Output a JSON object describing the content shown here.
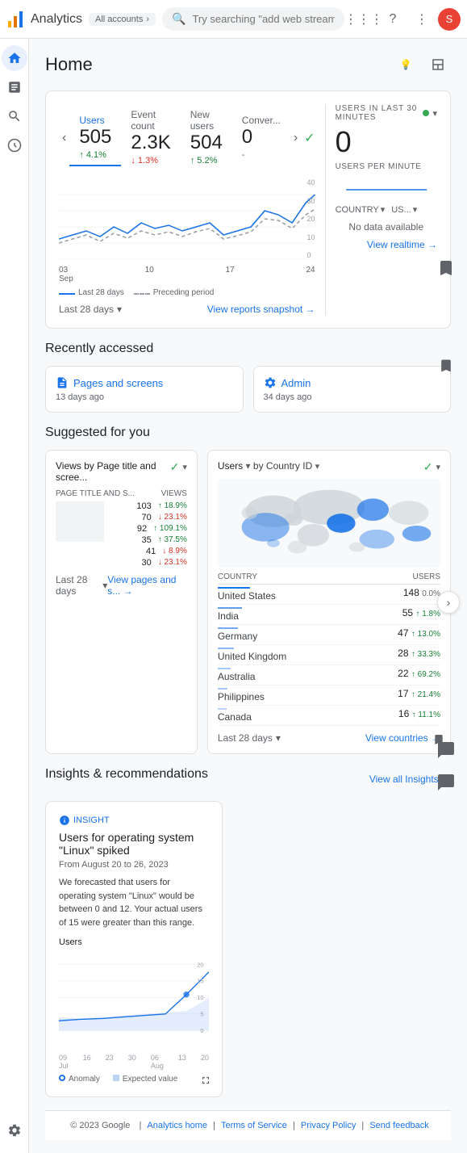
{
  "app": {
    "title": "Analytics",
    "account": "All accounts",
    "search_placeholder": "Try searching \"add web stream\"",
    "avatar_letter": "S"
  },
  "sidebar": {
    "items": [
      {
        "id": "home",
        "icon": "⌂",
        "label": "Home",
        "active": true
      },
      {
        "id": "reports",
        "icon": "📊",
        "label": "Reports"
      },
      {
        "id": "explore",
        "icon": "🔍",
        "label": "Explore"
      },
      {
        "id": "advertising",
        "icon": "📣",
        "label": "Advertising"
      },
      {
        "id": "configure",
        "icon": "⚙",
        "label": "Configure"
      }
    ]
  },
  "page": {
    "title": "Home"
  },
  "metrics": {
    "tabs": [
      {
        "id": "users",
        "label": "Users",
        "value": "505",
        "change": "↑ 4.1%",
        "change_type": "up"
      },
      {
        "id": "event_count",
        "label": "Event count",
        "value": "2.3K",
        "change": "↓ 1.3%",
        "change_type": "down"
      },
      {
        "id": "new_users",
        "label": "New users",
        "value": "504",
        "change": "↑ 5.2%",
        "change_type": "up"
      },
      {
        "id": "conversions",
        "label": "Conver...",
        "value": "0",
        "change": "-",
        "change_type": "neutral"
      }
    ],
    "chart_labels": [
      "03 Sep",
      "10",
      "17",
      "24"
    ],
    "chart_y_labels": [
      "40",
      "30",
      "20",
      "10",
      "0"
    ],
    "legend_solid": "Last 28 days",
    "legend_dashed": "Preceding period",
    "date_range": "Last 28 days",
    "view_link": "View reports snapshot →"
  },
  "realtime": {
    "title": "USERS IN LAST 30 MINUTES",
    "value": "0",
    "subtitle": "USERS PER MINUTE",
    "country_label": "COUNTRY",
    "us_label": "US...",
    "no_data": "No data available",
    "view_link": "View realtime →"
  },
  "recently_accessed": {
    "title": "Recently accessed",
    "items": [
      {
        "id": "pages-screens",
        "icon": "📄",
        "title": "Pages and screens",
        "sub": "13 days ago"
      },
      {
        "id": "admin",
        "icon": "⚙",
        "title": "Admin",
        "sub": "34 days ago"
      }
    ]
  },
  "suggested": {
    "title": "Suggested for you",
    "card1": {
      "title": "Views by Page title and scree...",
      "filter_label": "Views",
      "filter_icon": "✓",
      "columns": [
        "PAGE TITLE AND S...",
        "VIEWS"
      ],
      "rows": [
        {
          "views": "103",
          "change": "↑ 18.9%",
          "change_type": "up"
        },
        {
          "views": "70",
          "change": "↓ 23.1%",
          "change_type": "down"
        },
        {
          "views": "92",
          "change": "↑ 109.1%",
          "change_type": "up"
        },
        {
          "views": "35",
          "change": "↑ 37.5%",
          "change_type": "up"
        },
        {
          "views": "41",
          "change": "↓ 8.9%",
          "change_type": "down"
        },
        {
          "views": "30",
          "change": "↓ 23.1%",
          "change_type": "down"
        }
      ],
      "date_range": "Last 28 days",
      "view_link": "View pages and s... →"
    },
    "card2": {
      "title": "Users",
      "filter_label": "by Country ID",
      "filter_icon": "✓",
      "columns": [
        "COUNTRY",
        "USERS"
      ],
      "rows": [
        {
          "country": "United States",
          "users": "148",
          "change": "0.0%",
          "change_type": "neutral"
        },
        {
          "country": "India",
          "users": "55",
          "change": "↑ 1.8%",
          "change_type": "up"
        },
        {
          "country": "Germany",
          "users": "47",
          "change": "↑ 13.0%",
          "change_type": "up"
        },
        {
          "country": "United Kingdom",
          "users": "28",
          "change": "↑ 33.3%",
          "change_type": "up"
        },
        {
          "country": "Australia",
          "users": "22",
          "change": "↑ 69.2%",
          "change_type": "up"
        },
        {
          "country": "Philippines",
          "users": "17",
          "change": "↑ 21.4%",
          "change_type": "up"
        },
        {
          "country": "Canada",
          "users": "16",
          "change": "↑ 11.1%",
          "change_type": "up"
        }
      ],
      "date_range": "Last 28 days",
      "view_link": "View countries →"
    }
  },
  "insights": {
    "section_title": "Insights & recommendations",
    "view_all_link": "View all Insights →",
    "card": {
      "tag": "INSIGHT",
      "title": "Users for operating system \"Linux\" spiked",
      "date": "From August 20 to 26, 2023",
      "text": "We forecasted that users for operating system \"Linux\" would be between 0 and 12. Your actual users of 15 were greater than this range.",
      "users_label": "Users",
      "chart_x_labels": [
        "09",
        "16",
        "23",
        "30",
        "06",
        "13",
        "20"
      ],
      "chart_x_sublabels": [
        "Jul",
        "",
        "",
        "",
        "Aug",
        "",
        ""
      ],
      "chart_y_labels": [
        "20",
        "15",
        "10",
        "5",
        "0"
      ],
      "legend_anomaly": "Anomaly",
      "legend_expected": "Expected value"
    }
  },
  "footer": {
    "copyright": "© 2023 Google",
    "links": [
      "Analytics home",
      "Terms of Service",
      "Privacy Policy",
      "Send feedback"
    ]
  }
}
